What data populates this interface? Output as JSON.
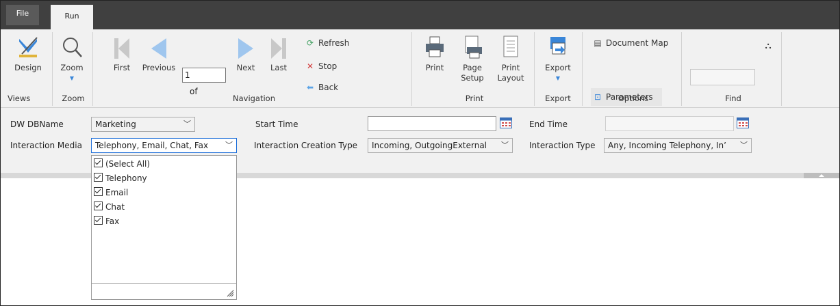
{
  "tabs": {
    "file": "File",
    "run": "Run"
  },
  "ribbon": {
    "views": {
      "design_label": "Design",
      "group_label": "Views"
    },
    "zoom": {
      "zoom_label": "Zoom",
      "group_label": "Zoom"
    },
    "navigation": {
      "first": "First",
      "previous": "Previous",
      "page_value": "1",
      "of_label": "of",
      "next": "Next",
      "last": "Last",
      "refresh": "Refresh",
      "stop": "Stop",
      "back": "Back",
      "group_label": "Navigation"
    },
    "print": {
      "print_label": "Print",
      "page_setup_line1": "Page",
      "page_setup_line2": "Setup",
      "print_layout_line1": "Print",
      "print_layout_line2": "Layout",
      "group_label": "Print"
    },
    "export": {
      "export_label": "Export",
      "group_label": "Export"
    },
    "options": {
      "document_map": "Document Map",
      "parameters": "Parameters",
      "group_label": "Options"
    },
    "find": {
      "group_label": "Find",
      "value": ""
    }
  },
  "params": {
    "dw_dbname": {
      "label": "DW DBName",
      "value": "Marketing"
    },
    "start_time": {
      "label": "Start Time",
      "value": ""
    },
    "end_time": {
      "label": "End Time",
      "value": ""
    },
    "interaction_media": {
      "label": "Interaction Media",
      "value": "Telephony, Email, Chat, Fax"
    },
    "interaction_creation_type": {
      "label": "Interaction Creation Type",
      "value": "Incoming, OutgoingExternal"
    },
    "interaction_type": {
      "label": "Interaction Type",
      "value": "Any, Incoming Telephony, In’"
    }
  },
  "dropdown": {
    "items": [
      {
        "label": "(Select All)",
        "checked": true
      },
      {
        "label": "Telephony",
        "checked": true
      },
      {
        "label": "Email",
        "checked": true
      },
      {
        "label": "Chat",
        "checked": true
      },
      {
        "label": "Fax",
        "checked": true
      }
    ]
  },
  "colors": {
    "tabstrip": "#404040",
    "ribbon": "#f1f1f1",
    "accent_blue": "#3a86d8",
    "refresh_green": "#3f9f5f",
    "stop_red": "#d23b3b"
  }
}
